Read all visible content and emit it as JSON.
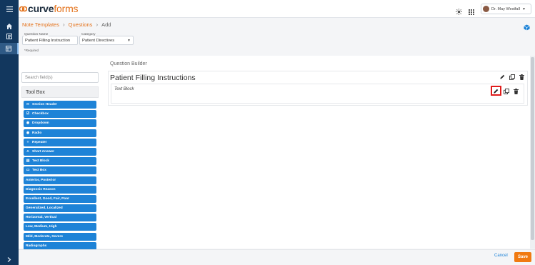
{
  "app": {
    "logo_part1": "curve",
    "logo_part2": "forms",
    "brand_color": "#e4731c",
    "nav_color": "#12375e"
  },
  "topbar": {
    "user_name": "Dr. May Westfall",
    "icons": [
      "menu-icon",
      "sun-icon",
      "apps-grid-icon"
    ]
  },
  "breadcrumb": {
    "item1": "Note Templates",
    "item2": "Questions",
    "current": "Add"
  },
  "form": {
    "question_name_label": "Question Name",
    "question_name_value": "Patient Filling Instruction",
    "category_label": "Category",
    "category_value": "Patient Directives",
    "required_note": "*Required"
  },
  "search": {
    "placeholder": "Search field(s)"
  },
  "toolbox": {
    "title": "Tool Box",
    "items": [
      {
        "label": "Section Header",
        "icon": "H"
      },
      {
        "label": "Checkbox",
        "icon": "☑"
      },
      {
        "label": "Dropdown",
        "icon": "◉"
      },
      {
        "label": "Radio",
        "icon": "◉"
      },
      {
        "label": "Repeater",
        "icon": "≡"
      },
      {
        "label": "Short Answer",
        "icon": "A"
      },
      {
        "label": "Text Block",
        "icon": "▤"
      },
      {
        "label": "Text Box",
        "icon": "▭"
      },
      {
        "label": "Anterior, Posterior",
        "icon": ""
      },
      {
        "label": "Diagnosis Reason",
        "icon": ""
      },
      {
        "label": "Excellent, Good, Fair, Poor",
        "icon": ""
      },
      {
        "label": "Generalized, Localized",
        "icon": ""
      },
      {
        "label": "Horizontal, Vertical",
        "icon": ""
      },
      {
        "label": "Low, Medium, High",
        "icon": ""
      },
      {
        "label": "Mild, Moderate, Severe",
        "icon": ""
      },
      {
        "label": "Radiographs",
        "icon": ""
      }
    ]
  },
  "builder": {
    "title": "Question Builder",
    "section_title": "Patient Filling Instructions",
    "block_label": "Text Block"
  },
  "footer": {
    "cancel_label": "Cancel",
    "save_label": "Save"
  }
}
